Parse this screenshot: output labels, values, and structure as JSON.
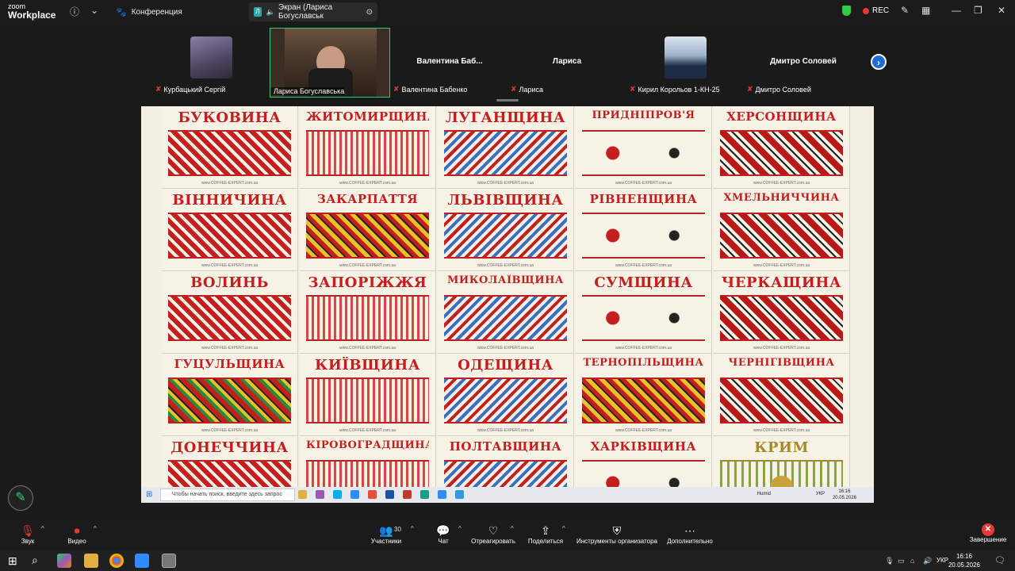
{
  "titlebar": {
    "logo_small": "zoom",
    "logo_big": "Workplace",
    "tab1_label": "Конференция",
    "tab2_avatar": "Л",
    "tab2_label": "Экран (Лариса Богуславськ",
    "rec_label": "REC"
  },
  "participants": [
    {
      "label": "Курбацький Сергій",
      "muted": true,
      "has_photo": true
    },
    {
      "label": "Лариса Богуславська",
      "muted": false,
      "has_video": true,
      "selected": true
    },
    {
      "label": "Валентина Бабенко",
      "big_name": "Валентина  Баб...",
      "muted": true
    },
    {
      "label": "Лариса",
      "big_name": "Лариса",
      "muted": true
    },
    {
      "label": "Кирил Корольов 1-КН-25",
      "muted": true,
      "has_photo": true
    },
    {
      "label": "Дмитро Соловей",
      "big_name": "Дмитро Соловей",
      "muted": true
    }
  ],
  "share": {
    "watermark": "www.COFFEE-EXPERT.com.ua",
    "regions": [
      {
        "name": "БУКОВИНА",
        "color": "#c41e1e"
      },
      {
        "name": "ЖИТОМИРЩИНА",
        "color": "#c41e1e"
      },
      {
        "name": "ЛУГАНЩИНА",
        "color": "#c41e1e"
      },
      {
        "name": "ПРИДНІПРОВ'Я",
        "color": "#c41e1e"
      },
      {
        "name": "ХЕРСОНЩИНА",
        "color": "#c41e1e"
      },
      {
        "name": "ВІННИЧИНА",
        "color": "#c41e1e"
      },
      {
        "name": "ЗАКАРПАТТЯ",
        "color": "#c41e1e"
      },
      {
        "name": "ЛЬВІВЩИНА",
        "color": "#c41e1e"
      },
      {
        "name": "РІВНЕНЩИНА",
        "color": "#c41e1e"
      },
      {
        "name": "ХМЕЛЬНИЧЧИНА",
        "color": "#c41e1e"
      },
      {
        "name": "ВОЛИНЬ",
        "color": "#c41e1e"
      },
      {
        "name": "ЗАПОРІЖЖЯ",
        "color": "#c41e1e"
      },
      {
        "name": "МИКОЛАЇВЩИНА",
        "color": "#c41e1e"
      },
      {
        "name": "СУМЩИНА",
        "color": "#c41e1e"
      },
      {
        "name": "ЧЕРКАЩИНА",
        "color": "#c41e1e"
      },
      {
        "name": "ГУЦУЛЬЩИНА",
        "color": "#c41e1e"
      },
      {
        "name": "КИЇВЩИНА",
        "color": "#c41e1e"
      },
      {
        "name": "ОДЕЩИНА",
        "color": "#c41e1e"
      },
      {
        "name": "ТЕРНОПІЛЬЩИНА",
        "color": "#c41e1e"
      },
      {
        "name": "ЧЕРНІГІВЩИНА",
        "color": "#c41e1e"
      },
      {
        "name": "ДОНЕЧЧИНА",
        "color": "#c41e1e"
      },
      {
        "name": "КІРОВОГРАДЩИНА",
        "color": "#c41e1e"
      },
      {
        "name": "ПОЛТАВЩИНА",
        "color": "#c41e1e"
      },
      {
        "name": "ХАРКІВЩИНА",
        "color": "#c41e1e"
      },
      {
        "name": "КРИМ",
        "color": "#a88a2a"
      }
    ],
    "remote_taskbar": {
      "search_placeholder": "Чтобы начать поиск, введите здесь запрос",
      "weather": "Humid",
      "lang": "УКР",
      "time": "16:16",
      "date": "20.05.2026"
    }
  },
  "toolbar": {
    "audio": "Звук",
    "video": "Видео",
    "participants": "Участники",
    "participants_count": "30",
    "chat": "Чат",
    "react": "Отреагировать",
    "share": "Поделиться",
    "host_tools": "Инструменты организатора",
    "more": "Дополнительно",
    "end": "Завершение"
  },
  "taskbar": {
    "lang": "УКР",
    "time": "16:16",
    "date": "20.05.2026"
  }
}
